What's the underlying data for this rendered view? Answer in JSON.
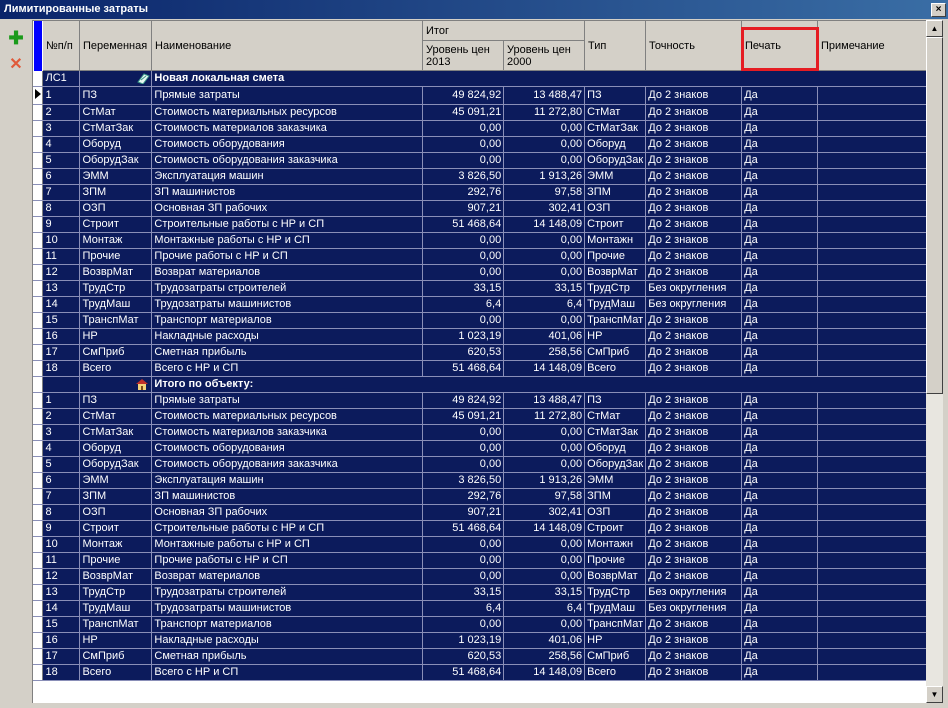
{
  "window": {
    "title": "Лимитированные затраты",
    "close_glyph": "×"
  },
  "toolbar": {
    "add_glyph": "✚",
    "delete_glyph": "✕"
  },
  "columns": {
    "num": "№п/п",
    "variable": "Переменная",
    "name": "Наименование",
    "total_group": "Итог",
    "price2013": "Уровень цен 2013",
    "price2000": "Уровень цен 2000",
    "type": "Тип",
    "precision": "Точность",
    "print": "Печать",
    "note": "Примечание"
  },
  "highlight_color": "#e51c23",
  "sections": [
    {
      "code": "ЛС1",
      "title": "Новая локальная смета",
      "icon": "estimate-icon",
      "rows": [
        [
          "1",
          "ПЗ",
          "Прямые затраты",
          "49 824,92",
          "13 488,47",
          "ПЗ",
          "До 2 знаков",
          "Да"
        ],
        [
          "2",
          "СтМат",
          "Стоимость материальных ресурсов",
          "45 091,21",
          "11 272,80",
          "СтМат",
          "До 2 знаков",
          "Да"
        ],
        [
          "3",
          "СтМатЗак",
          "Стоимость материалов заказчика",
          "0,00",
          "0,00",
          "СтМатЗак",
          "До 2 знаков",
          "Да"
        ],
        [
          "4",
          "Оборуд",
          "Стоимость оборудования",
          "0,00",
          "0,00",
          "Оборуд",
          "До 2 знаков",
          "Да"
        ],
        [
          "5",
          "ОборудЗак",
          "Стоимость оборудования заказчика",
          "0,00",
          "0,00",
          "ОборудЗак",
          "До 2 знаков",
          "Да"
        ],
        [
          "6",
          "ЭММ",
          "Эксплуатация машин",
          "3 826,50",
          "1 913,26",
          "ЭММ",
          "До 2 знаков",
          "Да"
        ],
        [
          "7",
          "ЗПМ",
          "ЗП машинистов",
          "292,76",
          "97,58",
          "ЗПМ",
          "До 2 знаков",
          "Да"
        ],
        [
          "8",
          "ОЗП",
          "Основная ЗП рабочих",
          "907,21",
          "302,41",
          "ОЗП",
          "До 2 знаков",
          "Да"
        ],
        [
          "9",
          "Строит",
          "Строительные работы с НР и СП",
          "51 468,64",
          "14 148,09",
          "Строит",
          "До 2 знаков",
          "Да"
        ],
        [
          "10",
          "Монтаж",
          "Монтажные работы с НР и СП",
          "0,00",
          "0,00",
          "Монтажн",
          "До 2 знаков",
          "Да"
        ],
        [
          "11",
          "Прочие",
          "Прочие работы с НР и СП",
          "0,00",
          "0,00",
          "Прочие",
          "До 2 знаков",
          "Да"
        ],
        [
          "12",
          "ВозврМат",
          "Возврат материалов",
          "0,00",
          "0,00",
          "ВозврМат",
          "До 2 знаков",
          "Да"
        ],
        [
          "13",
          "ТрудСтр",
          "Трудозатраты строителей",
          "33,15",
          "33,15",
          "ТрудСтр",
          "Без округления",
          "Да"
        ],
        [
          "14",
          "ТрудМаш",
          "Трудозатраты машинистов",
          "6,4",
          "6,4",
          "ТрудМаш",
          "Без округления",
          "Да"
        ],
        [
          "15",
          "ТранспМат",
          "Транспорт материалов",
          "0,00",
          "0,00",
          "ТранспМат",
          "До 2 знаков",
          "Да"
        ],
        [
          "16",
          "НР",
          "Накладные расходы",
          "1 023,19",
          "401,06",
          "НР",
          "До 2 знаков",
          "Да"
        ],
        [
          "17",
          "СмПриб",
          "Сметная прибыль",
          "620,53",
          "258,56",
          "СмПриб",
          "До 2 знаков",
          "Да"
        ],
        [
          "18",
          "Всего",
          "Всего с НР и СП",
          "51 468,64",
          "14 148,09",
          "Всего",
          "До 2 знаков",
          "Да"
        ]
      ]
    },
    {
      "code": "",
      "title": "Итого по объекту:",
      "icon": "house-icon",
      "rows": [
        [
          "1",
          "ПЗ",
          "Прямые затраты",
          "49 824,92",
          "13 488,47",
          "ПЗ",
          "До 2 знаков",
          "Да"
        ],
        [
          "2",
          "СтМат",
          "Стоимость материальных ресурсов",
          "45 091,21",
          "11 272,80",
          "СтМат",
          "До 2 знаков",
          "Да"
        ],
        [
          "3",
          "СтМатЗак",
          "Стоимость материалов заказчика",
          "0,00",
          "0,00",
          "СтМатЗак",
          "До 2 знаков",
          "Да"
        ],
        [
          "4",
          "Оборуд",
          "Стоимость оборудования",
          "0,00",
          "0,00",
          "Оборуд",
          "До 2 знаков",
          "Да"
        ],
        [
          "5",
          "ОборудЗак",
          "Стоимость оборудования заказчика",
          "0,00",
          "0,00",
          "ОборудЗак",
          "До 2 знаков",
          "Да"
        ],
        [
          "6",
          "ЭММ",
          "Эксплуатация машин",
          "3 826,50",
          "1 913,26",
          "ЭММ",
          "До 2 знаков",
          "Да"
        ],
        [
          "7",
          "ЗПМ",
          "ЗП машинистов",
          "292,76",
          "97,58",
          "ЗПМ",
          "До 2 знаков",
          "Да"
        ],
        [
          "8",
          "ОЗП",
          "Основная ЗП рабочих",
          "907,21",
          "302,41",
          "ОЗП",
          "До 2 знаков",
          "Да"
        ],
        [
          "9",
          "Строит",
          "Строительные работы с НР и СП",
          "51 468,64",
          "14 148,09",
          "Строит",
          "До 2 знаков",
          "Да"
        ],
        [
          "10",
          "Монтаж",
          "Монтажные работы с НР и СП",
          "0,00",
          "0,00",
          "Монтажн",
          "До 2 знаков",
          "Да"
        ],
        [
          "11",
          "Прочие",
          "Прочие работы с НР и СП",
          "0,00",
          "0,00",
          "Прочие",
          "До 2 знаков",
          "Да"
        ],
        [
          "12",
          "ВозврМат",
          "Возврат материалов",
          "0,00",
          "0,00",
          "ВозврМат",
          "До 2 знаков",
          "Да"
        ],
        [
          "13",
          "ТрудСтр",
          "Трудозатраты строителей",
          "33,15",
          "33,15",
          "ТрудСтр",
          "Без округления",
          "Да"
        ],
        [
          "14",
          "ТрудМаш",
          "Трудозатраты машинистов",
          "6,4",
          "6,4",
          "ТрудМаш",
          "Без округления",
          "Да"
        ],
        [
          "15",
          "ТранспМат",
          "Транспорт материалов",
          "0,00",
          "0,00",
          "ТранспМат",
          "До 2 знаков",
          "Да"
        ],
        [
          "16",
          "НР",
          "Накладные расходы",
          "1 023,19",
          "401,06",
          "НР",
          "До 2 знаков",
          "Да"
        ],
        [
          "17",
          "СмПриб",
          "Сметная прибыль",
          "620,53",
          "258,56",
          "СмПриб",
          "До 2 знаков",
          "Да"
        ],
        [
          "18",
          "Всего",
          "Всего с НР и СП",
          "51 468,64",
          "14 148,09",
          "Всего",
          "До 2 знаков",
          "Да"
        ]
      ]
    }
  ],
  "scrollbar": {
    "up_glyph": "▲",
    "down_glyph": "▼"
  }
}
